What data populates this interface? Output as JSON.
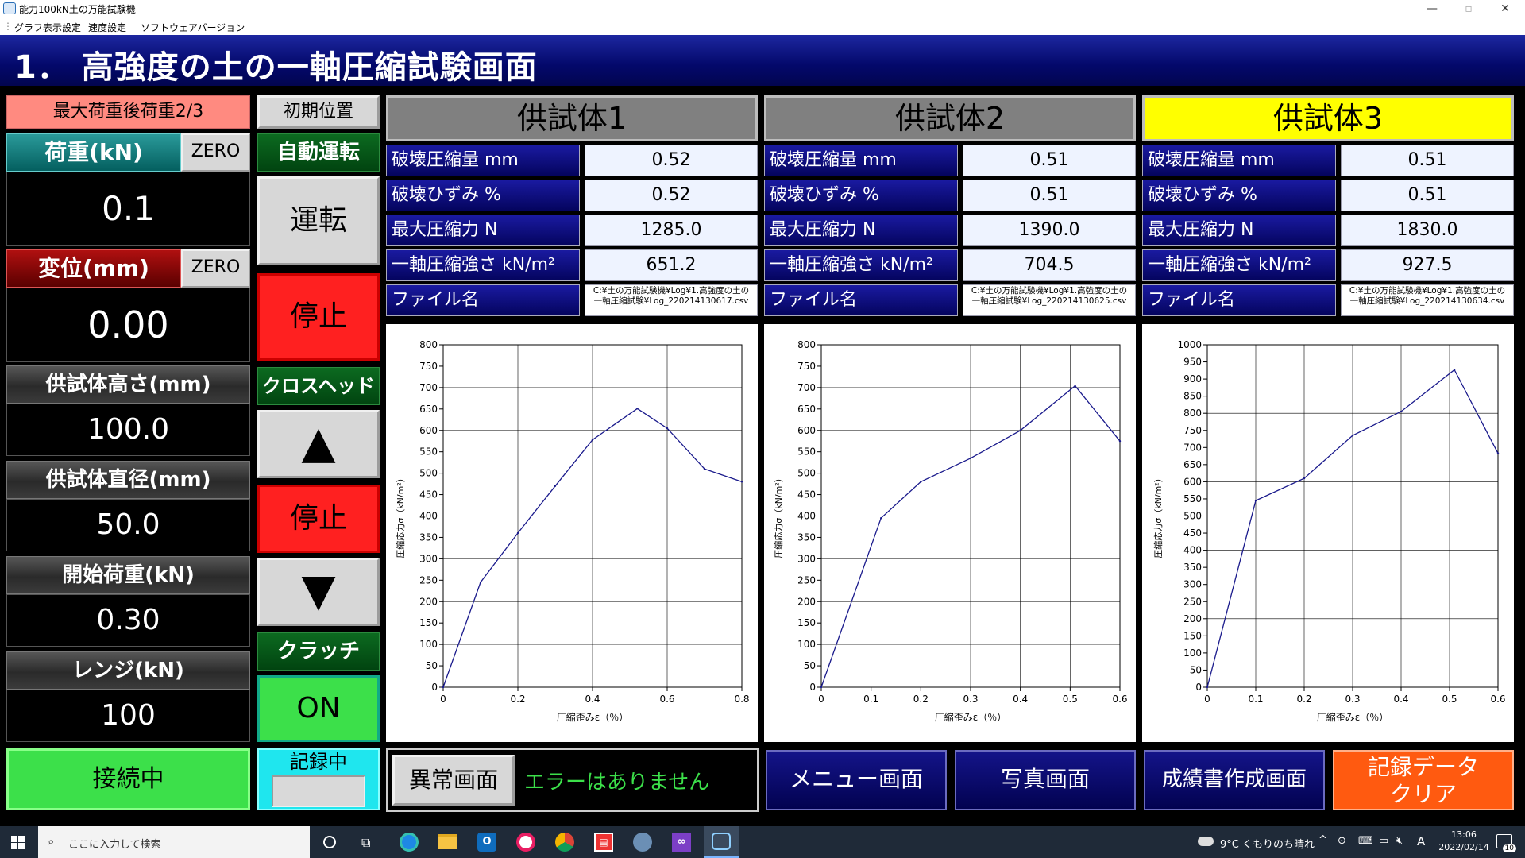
{
  "window": {
    "title": "能力100kN土の万能試験機",
    "menu": [
      "グラフ表示設定",
      "速度設定",
      "ソフトウェアバージョン"
    ]
  },
  "header": {
    "title": "1． 高強度の土の一軸圧縮試験画面"
  },
  "left": {
    "mode_label": "最大荷重後荷重2/3",
    "zero_label": "ZERO",
    "load": {
      "label": "荷重(kN)",
      "value": "0.1"
    },
    "displacement": {
      "label": "変位(mm)",
      "value": "0.00"
    },
    "height": {
      "label": "供試体高さ(mm)",
      "value": "100.0"
    },
    "diameter": {
      "label": "供試体直径(mm)",
      "value": "50.0"
    },
    "start_load": {
      "label": "開始荷重(kN)",
      "value": "0.30"
    },
    "range": {
      "label": "レンジ(kN)",
      "value": "100"
    },
    "connect": "接続中"
  },
  "controls": {
    "initial_position": "初期位置",
    "auto_run": "自動運転",
    "run": "運転",
    "stop1": "停止",
    "crosshead": "クロスヘッド",
    "up": "▲",
    "stop2": "停止",
    "down": "▼",
    "clutch": "クラッチ",
    "on": "ON",
    "recording": "記録中"
  },
  "field_labels": {
    "fracture_compression": "破壊圧縮量 mm",
    "fracture_strain": "破壊ひずみ %",
    "max_force": "最大圧縮力 N",
    "ucs": "一軸圧縮強さ kN/m²",
    "filename": "ファイル名"
  },
  "specimens": [
    {
      "name": "供試体1",
      "fracture_compression": "0.52",
      "fracture_strain": "0.52",
      "max_force": "1285.0",
      "ucs": "651.2",
      "file_line1": "C:¥土の万能試験機¥Log¥1.高強度の土の",
      "file_line2": "一軸圧縮試験¥Log_220214130617.csv",
      "active": false
    },
    {
      "name": "供試体2",
      "fracture_compression": "0.51",
      "fracture_strain": "0.51",
      "max_force": "1390.0",
      "ucs": "704.5",
      "file_line1": "C:¥土の万能試験機¥Log¥1.高強度の土の",
      "file_line2": "一軸圧縮試験¥Log_220214130625.csv",
      "active": false
    },
    {
      "name": "供試体3",
      "fracture_compression": "0.51",
      "fracture_strain": "0.51",
      "max_force": "1830.0",
      "ucs": "927.5",
      "file_line1": "C:¥土の万能試験機¥Log¥1.高強度の土の",
      "file_line2": "一軸圧縮試験¥Log_220214130634.csv",
      "active": true
    }
  ],
  "chart_data": [
    {
      "type": "line",
      "xlabel": "圧縮歪みε（％）",
      "ylabel": "圧縮応力σ（kN/m²）",
      "xlim": [
        0,
        0.8
      ],
      "xticks": [
        0,
        0.2,
        0.4,
        0.6,
        0.8
      ],
      "ylim": [
        0,
        800
      ],
      "ystep": 50,
      "grid": true,
      "x": [
        0,
        0.1,
        0.2,
        0.3,
        0.4,
        0.52,
        0.6,
        0.7,
        0.8
      ],
      "y": [
        0,
        245,
        360,
        470,
        578,
        651,
        605,
        510,
        480
      ]
    },
    {
      "type": "line",
      "xlabel": "圧縮歪みε（％）",
      "ylabel": "圧縮応力σ（kN/m²）",
      "xlim": [
        0,
        0.6
      ],
      "xticks": [
        0,
        0.1,
        0.2,
        0.3,
        0.4,
        0.5,
        0.6
      ],
      "ylim": [
        0,
        800
      ],
      "ystep": 50,
      "grid": true,
      "x": [
        0,
        0.12,
        0.2,
        0.3,
        0.4,
        0.51,
        0.6
      ],
      "y": [
        0,
        395,
        480,
        535,
        600,
        704,
        575
      ]
    },
    {
      "type": "line",
      "xlabel": "圧縮歪みε（％）",
      "ylabel": "圧縮応力σ（kN/m²）",
      "xlim": [
        0,
        0.6
      ],
      "xticks": [
        0,
        0.1,
        0.2,
        0.3,
        0.4,
        0.5,
        0.6
      ],
      "ylim": [
        0,
        1000
      ],
      "ystep": 50,
      "grid": true,
      "x": [
        0,
        0.1,
        0.2,
        0.3,
        0.4,
        0.51,
        0.6
      ],
      "y": [
        0,
        545,
        610,
        735,
        805,
        927,
        683
      ]
    }
  ],
  "status": {
    "abnormal_button": "異常画面",
    "message": "エラーはありません"
  },
  "nav": {
    "menu": "メニュー画面",
    "photo": "写真画面",
    "report": "成績書作成画面",
    "clear_line1": "記録データ",
    "clear_line2": "クリア"
  },
  "taskbar": {
    "search_placeholder": "ここに入力して検索",
    "weather": "9°C くもりのち晴れ",
    "time": "13:06",
    "date": "2022/02/14",
    "ime": "A",
    "notifications": "10"
  }
}
